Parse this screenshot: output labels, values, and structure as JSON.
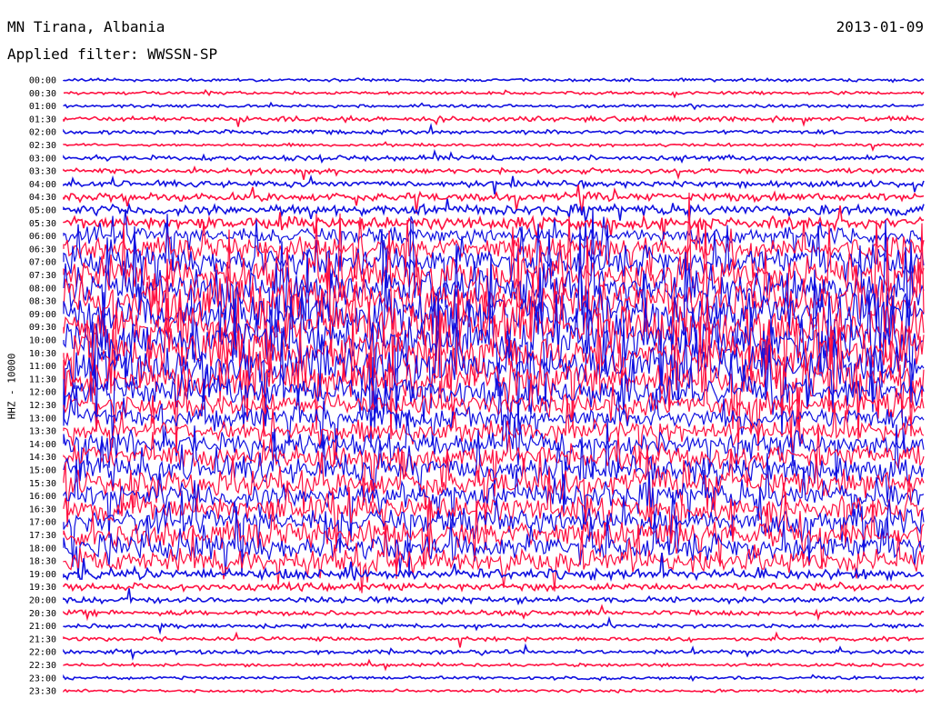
{
  "header": {
    "station": "MN Tirana, Albania",
    "date": "2013-01-09",
    "filter": "Applied filter: WWSSN-SP"
  },
  "chart_data": {
    "type": "line",
    "title": "MN Tirana, Albania",
    "ylabel": "HHZ - 10000",
    "ylim": [
      "00:00",
      "23:30"
    ],
    "grid": false,
    "series_colors": [
      "#1010e0",
      "#ff1040"
    ],
    "tick_labels": [
      "00:00",
      "00:30",
      "01:00",
      "01:30",
      "02:00",
      "02:30",
      "03:00",
      "03:30",
      "04:00",
      "04:30",
      "05:00",
      "05:30",
      "06:00",
      "06:30",
      "07:00",
      "07:30",
      "08:00",
      "08:30",
      "09:00",
      "09:30",
      "10:00",
      "10:30",
      "11:00",
      "11:30",
      "12:00",
      "12:30",
      "13:00",
      "13:30",
      "14:00",
      "14:30",
      "15:00",
      "15:30",
      "16:00",
      "16:30",
      "17:00",
      "17:30",
      "18:00",
      "18:30",
      "19:00",
      "19:30",
      "20:00",
      "20:30",
      "21:00",
      "21:30",
      "22:00",
      "22:30",
      "23:00",
      "23:30"
    ],
    "trace_activity": [
      0.3,
      0.3,
      0.3,
      0.5,
      0.4,
      0.3,
      0.5,
      0.5,
      0.6,
      0.8,
      1.0,
      1.2,
      1.6,
      2.2,
      3.0,
      3.5,
      3.8,
      4.0,
      4.0,
      4.0,
      4.0,
      4.0,
      4.0,
      3.6,
      2.8,
      2.2,
      2.0,
      2.0,
      2.2,
      2.4,
      2.5,
      2.5,
      2.4,
      2.4,
      2.5,
      2.6,
      2.6,
      2.2,
      1.0,
      0.7,
      0.6,
      0.5,
      0.4,
      0.4,
      0.4,
      0.3,
      0.3,
      0.3
    ]
  }
}
